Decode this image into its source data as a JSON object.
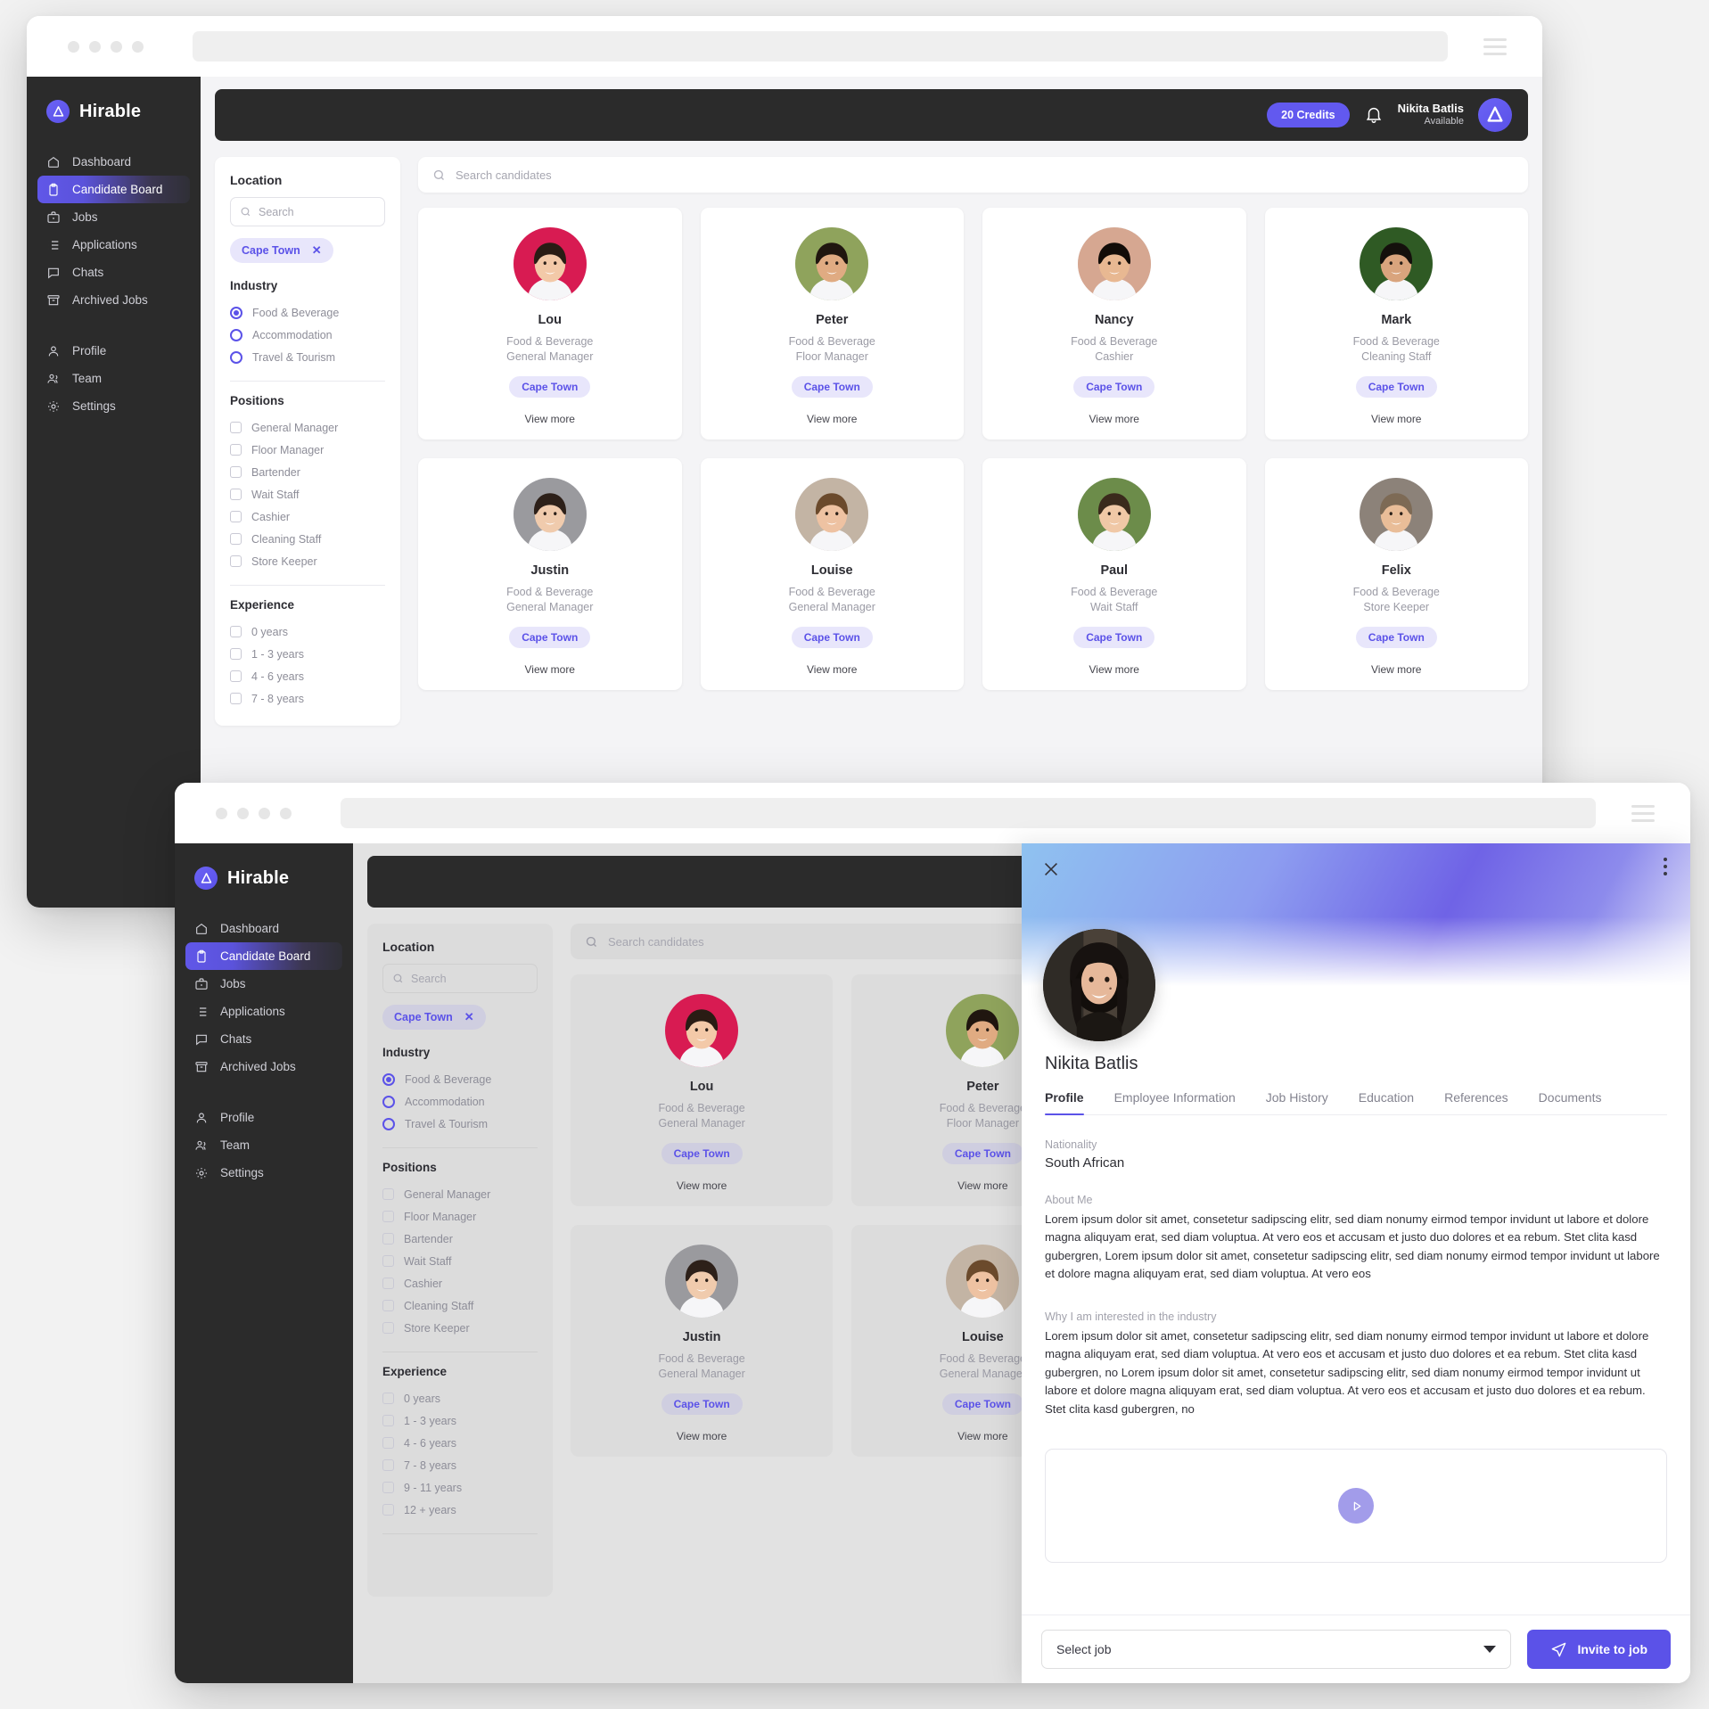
{
  "brand": {
    "name": "Hirable",
    "logo_icon": "hirable-logo-icon"
  },
  "colors": {
    "accent": "#5b52e8",
    "credits_bg": "#6259ef",
    "nav_bg": "#2b2b2b",
    "chip_bg": "#e8e6fb"
  },
  "sidebar": {
    "items": [
      {
        "label": "Dashboard",
        "icon": "home-icon",
        "active": false
      },
      {
        "label": "Candidate Board",
        "icon": "clipboard-icon",
        "active": true
      },
      {
        "label": "Jobs",
        "icon": "briefcase-icon",
        "active": false
      },
      {
        "label": "Applications",
        "icon": "list-icon",
        "active": false
      },
      {
        "label": "Chats",
        "icon": "chat-icon",
        "active": false
      },
      {
        "label": "Archived Jobs",
        "icon": "archive-icon",
        "active": false
      }
    ],
    "secondary": [
      {
        "label": "Profile",
        "icon": "user-icon"
      },
      {
        "label": "Team",
        "icon": "users-icon"
      },
      {
        "label": "Settings",
        "icon": "gear-icon"
      }
    ]
  },
  "topbar": {
    "credits": "20 Credits",
    "bell_icon": "bell-icon",
    "user_name": "Nikita Batlis",
    "user_status": "Available",
    "avatar_icon": "hirable-logo-icon"
  },
  "filters": {
    "location_title": "Location",
    "location_search_placeholder": "Search",
    "search_icon": "search-icon",
    "selected_location": "Cape Town",
    "remove_icon": "close-icon",
    "industry_title": "Industry",
    "industries": [
      {
        "label": "Food & Beverage",
        "selected": true
      },
      {
        "label": "Accommodation",
        "selected": false
      },
      {
        "label": "Travel & Tourism",
        "selected": false
      }
    ],
    "positions_title": "Positions",
    "positions": [
      {
        "label": "General Manager",
        "checked": false
      },
      {
        "label": "Floor Manager",
        "checked": false
      },
      {
        "label": "Bartender",
        "checked": false
      },
      {
        "label": "Wait Staff",
        "checked": false
      },
      {
        "label": "Cashier",
        "checked": false
      },
      {
        "label": "Cleaning Staff",
        "checked": false
      },
      {
        "label": "Store Keeper",
        "checked": false
      }
    ],
    "experience_title": "Experience",
    "experience": [
      {
        "label": "0 years",
        "checked": false
      },
      {
        "label": "1 - 3 years",
        "checked": false
      },
      {
        "label": "4 - 6 years",
        "checked": false
      },
      {
        "label": "7 - 8 years",
        "checked": false
      },
      {
        "label": "9 - 11 years",
        "checked": false
      },
      {
        "label": "12 + years",
        "checked": false
      }
    ]
  },
  "board": {
    "search_placeholder": "Search candidates",
    "search_icon": "search-icon",
    "view_more_label": "View more",
    "candidates": [
      {
        "name": "Lou",
        "industry": "Food & Beverage",
        "position": "General Manager",
        "location": "Cape Town",
        "skin": "#f3c9a8",
        "hair": "#2a1c14",
        "bg": "#d81b52"
      },
      {
        "name": "Peter",
        "industry": "Food & Beverage",
        "position": "Floor Manager",
        "location": "Cape Town",
        "skin": "#e0ab82",
        "hair": "#20160f",
        "bg": "#8fa35c"
      },
      {
        "name": "Nancy",
        "industry": "Food & Beverage",
        "position": "Cashier",
        "location": "Cape Town",
        "skin": "#e8b892",
        "hair": "#120c08",
        "bg": "#d6a791"
      },
      {
        "name": "Mark",
        "industry": "Food & Beverage",
        "position": "Cleaning Staff",
        "location": "Cape Town",
        "skin": "#d9a47d",
        "hair": "#14100c",
        "bg": "#2f5a24"
      },
      {
        "name": "Justin",
        "industry": "Food & Beverage",
        "position": "General Manager",
        "location": "Cape Town",
        "skin": "#f0cbad",
        "hair": "#2d2019",
        "bg": "#9a9a9e"
      },
      {
        "name": "Louise",
        "industry": "Food & Beverage",
        "position": "General Manager",
        "location": "Cape Town",
        "skin": "#eec2a2",
        "hair": "#6b4a2c",
        "bg": "#c3b4a4"
      },
      {
        "name": "Paul",
        "industry": "Food & Beverage",
        "position": "Wait Staff",
        "location": "Cape Town",
        "skin": "#f0c8a6",
        "hair": "#3a2a1c",
        "bg": "#6c8c4a"
      },
      {
        "name": "Felix",
        "industry": "Food & Beverage",
        "position": "Store Keeper",
        "location": "Cape Town",
        "skin": "#e9bd98",
        "hair": "#7d6a55",
        "bg": "#8c8279"
      }
    ]
  },
  "drawer": {
    "close_icon": "close-icon",
    "kebab_icon": "more-vertical-icon",
    "avatar_icon": "avatar",
    "name": "Nikita Batlis",
    "tabs": [
      {
        "label": "Profile",
        "active": true
      },
      {
        "label": "Employee Information",
        "active": false
      },
      {
        "label": "Job History",
        "active": false
      },
      {
        "label": "Education",
        "active": false
      },
      {
        "label": "References",
        "active": false
      },
      {
        "label": "Documents",
        "active": false
      }
    ],
    "nationality_label": "Nationality",
    "nationality_value": "South African",
    "about_label": "About Me",
    "about_text": "Lorem ipsum dolor sit amet, consetetur sadipscing elitr, sed diam nonumy eirmod tempor invidunt ut labore et dolore magna aliquyam erat, sed diam voluptua. At vero eos et accusam et justo duo dolores et ea rebum. Stet clita kasd gubergren,  Lorem ipsum dolor sit amet, consetetur sadipscing elitr, sed diam nonumy eirmod tempor invidunt ut labore et dolore magna aliquyam erat, sed diam voluptua. At vero eos",
    "industry_label": "Why I am interested in the industry",
    "industry_text": "Lorem ipsum dolor sit amet, consetetur sadipscing elitr, sed diam nonumy eirmod tempor invidunt ut labore et dolore magna aliquyam erat, sed diam voluptua. At vero eos et accusam et justo duo dolores et ea rebum. Stet clita kasd gubergren, no Lorem ipsum dolor sit amet, consetetur sadipscing elitr, sed diam nonumy eirmod tempor invidunt ut labore et dolore magna aliquyam erat, sed diam voluptua. At vero eos et accusam et justo duo dolores et ea rebum. Stet clita kasd gubergren, no",
    "play_icon": "play-icon",
    "select_job_label": "Select job",
    "invite_label": "Invite to job",
    "invite_icon": "send-icon",
    "caret_icon": "chevron-down-icon"
  }
}
